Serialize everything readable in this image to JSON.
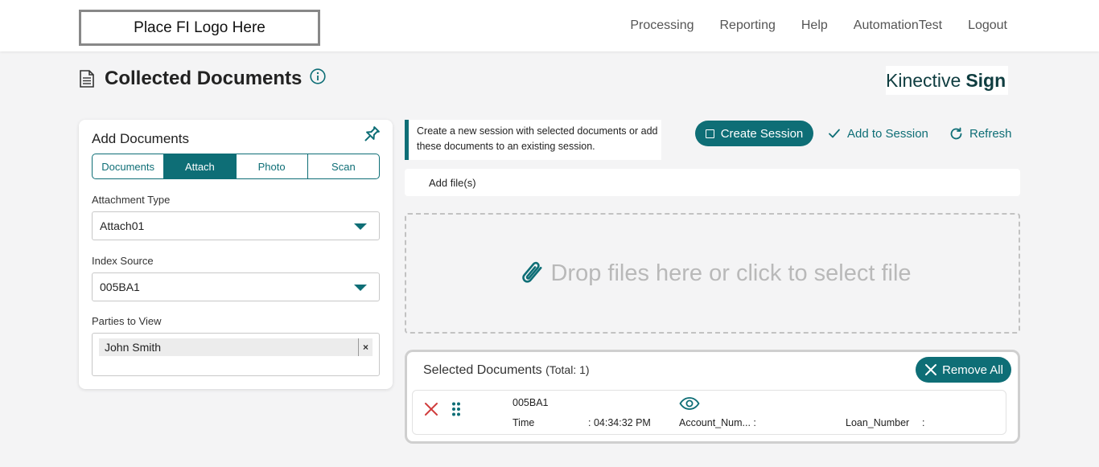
{
  "header": {
    "logo_text": "Place FI Logo Here",
    "nav": [
      "Processing",
      "Reporting",
      "Help",
      "AutomationTest",
      "Logout"
    ]
  },
  "page": {
    "title": "Collected Documents",
    "brand_light": "Kinective",
    "brand_bold": "Sign"
  },
  "add_documents": {
    "title": "Add Documents",
    "tabs": [
      "Documents",
      "Attach",
      "Photo",
      "Scan"
    ],
    "active_tab": "Attach",
    "attachment_type_label": "Attachment Type",
    "attachment_type_value": "Attach01",
    "index_source_label": "Index Source",
    "index_source_value": "005BA1",
    "parties_label": "Parties to View",
    "parties": [
      "John Smith"
    ],
    "chip_remove": "×"
  },
  "actions": {
    "hint": "Create a new session with selected documents or add these documents to an existing session.",
    "create_session": "Create Session",
    "add_to_session": "Add to Session",
    "refresh": "Refresh"
  },
  "upload": {
    "add_files": "Add file(s)",
    "drop_text": "Drop files here or click to select file"
  },
  "selected": {
    "title": "Selected Documents",
    "total": "(Total: 1)",
    "remove_all": "Remove All",
    "rows": [
      {
        "name": "005BA1",
        "time_label": "Time",
        "time_value": ": 04:34:32 PM",
        "account_label": "Account_Num... :",
        "loan_label": "Loan_Number",
        "loan_sep": ":"
      }
    ]
  },
  "colors": {
    "accent": "#0e6e76",
    "danger": "#d03c3c",
    "background": "#f4f4f5"
  },
  "icons": [
    "document-icon",
    "info-icon",
    "pin-icon",
    "caret-down-icon",
    "checkbox-square-icon",
    "check-icon",
    "refresh-icon",
    "paperclip-icon",
    "close-icon",
    "drag-handle-icon",
    "eye-icon"
  ]
}
